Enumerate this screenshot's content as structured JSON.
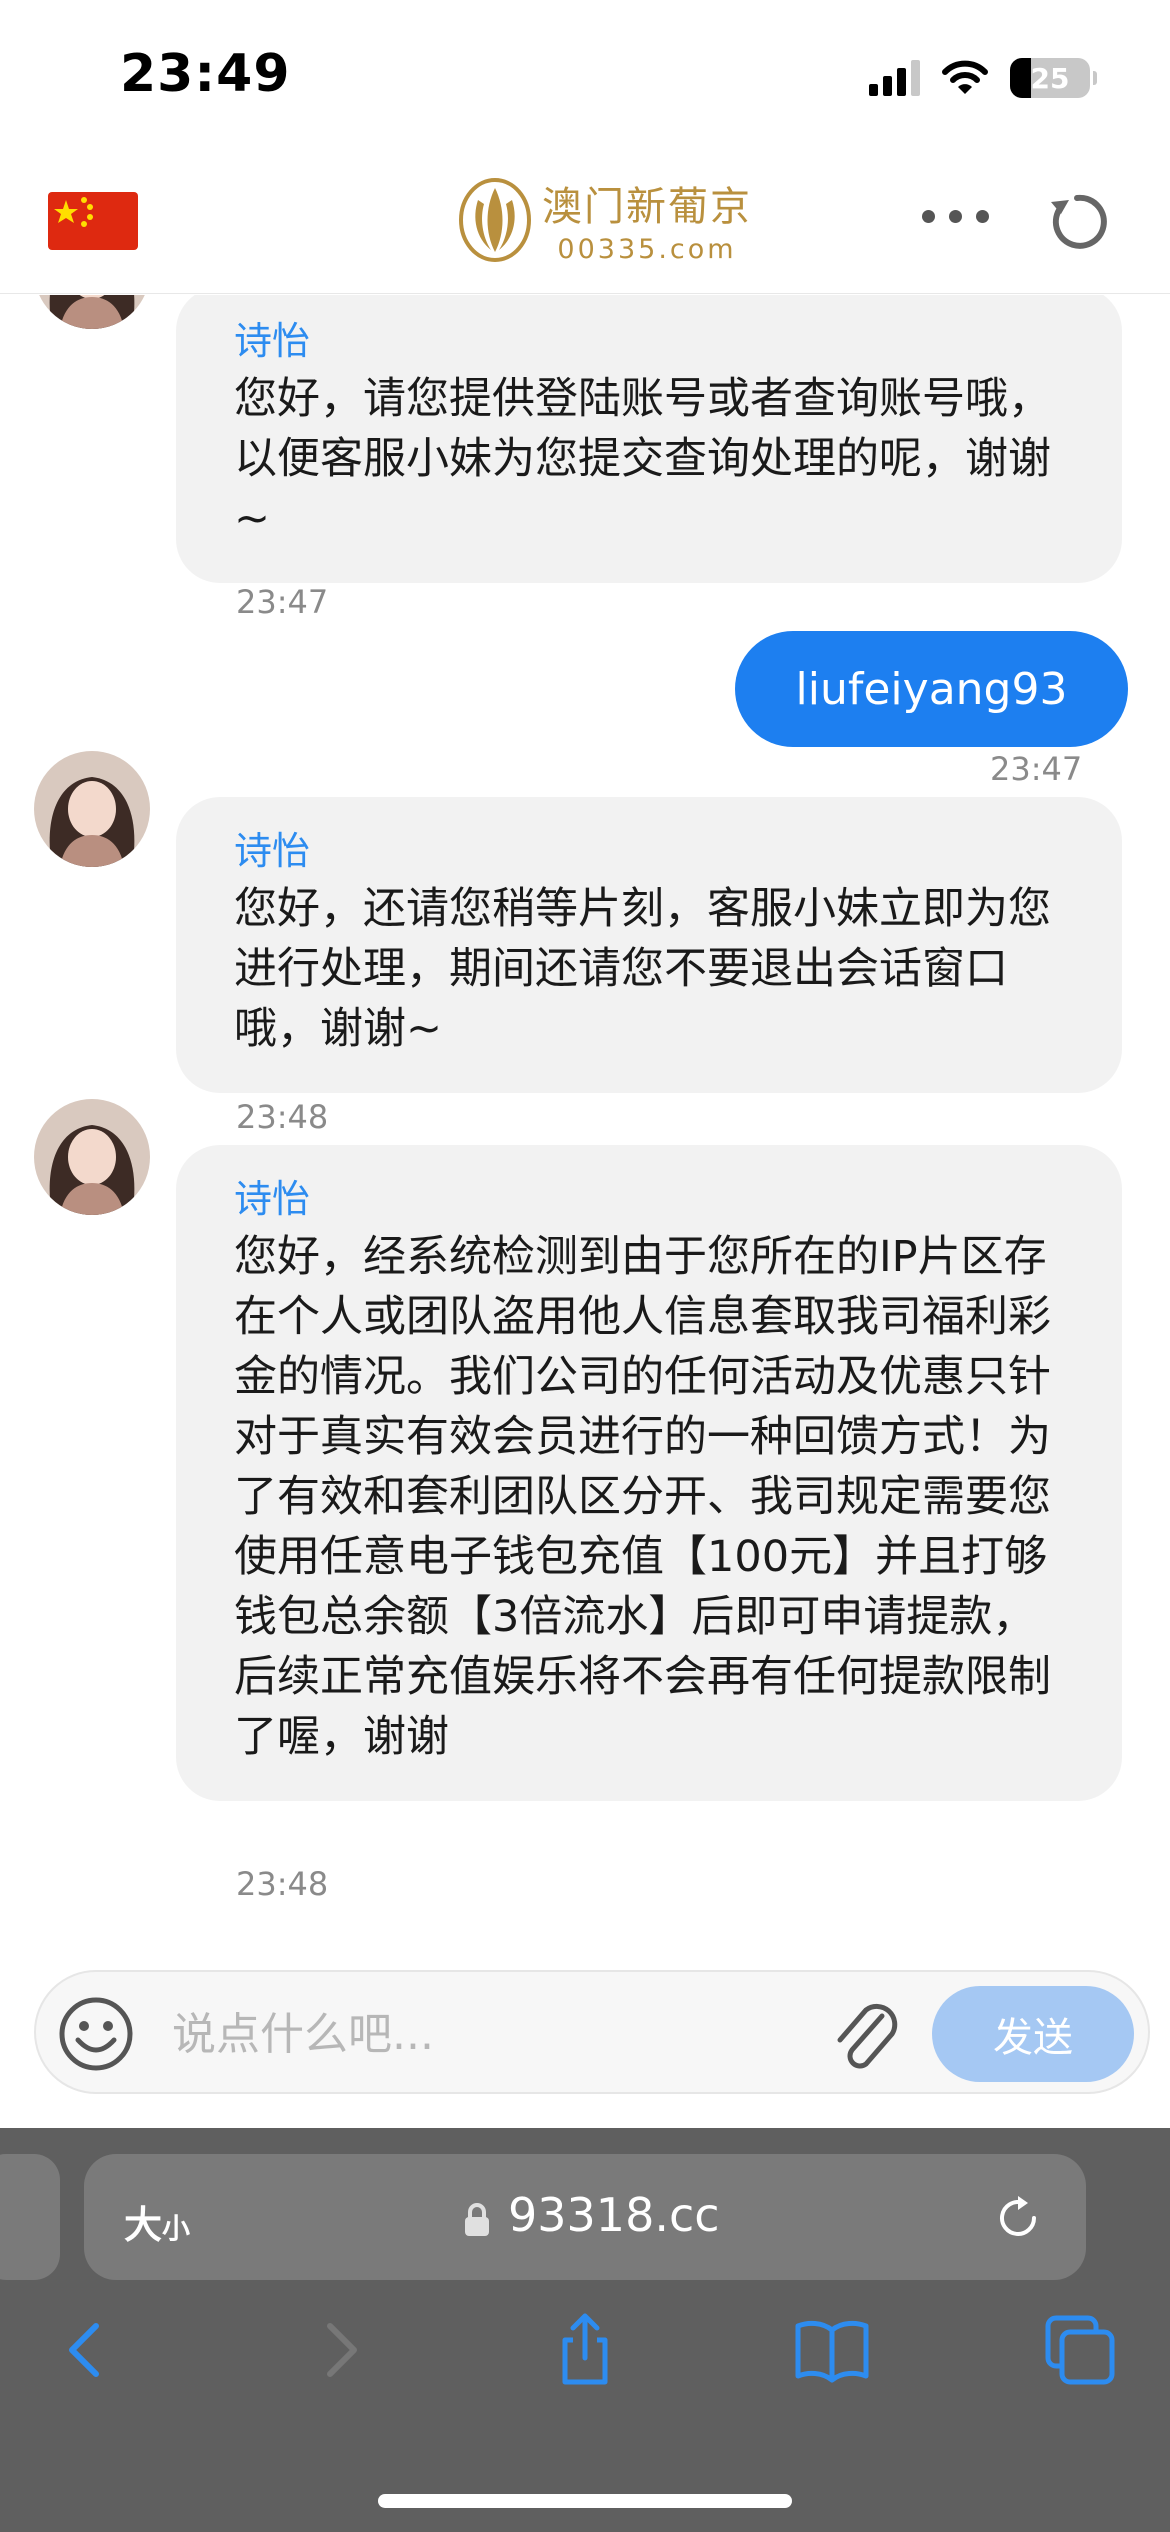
{
  "status_bar": {
    "time": "23:49",
    "battery": "25"
  },
  "header": {
    "logo_title": "澳门新葡京",
    "logo_domain": "00335.com"
  },
  "messages": [
    {
      "sender": "诗怡",
      "text": "您好，请您提供登陆账号或者查询账号哦，以便客服小妹为您提交查询处理的呢，谢谢~",
      "time": "23:47"
    },
    {
      "text": "liufeiyang93",
      "time": "23:47"
    },
    {
      "sender": "诗怡",
      "text": "您好，还请您稍等片刻，客服小妹立即为您进行处理，期间还请您不要退出会话窗口哦，谢谢~",
      "time": "23:48"
    },
    {
      "sender": "诗怡",
      "text": "您好，经系统检测到由于您所在的IP片区存在个人或团队盗用他人信息套取我司福利彩金的情况。我们公司的任何活动及优惠只针对于真实有效会员进行的一种回馈方式！为了有效和套利团队区分开、我司规定需要您使用任意电子钱包充值【100元】并且打够钱包总余额【3倍流水】后即可申请提款，后续正常充值娱乐将不会再有任何提款限制了喔，谢谢",
      "time": "23:48"
    }
  ],
  "input": {
    "placeholder": "说点什么吧...",
    "send_label": "发送"
  },
  "browser": {
    "reader_label": "大",
    "reader_small": "小",
    "url": "93318.cc"
  },
  "icons": {
    "flag": "china-flag-icon",
    "logo": "grand-lisboa-logo",
    "more": "more-dots-icon",
    "refresh": "refresh-icon",
    "emoji": "emoji-icon",
    "attach": "paperclip-icon",
    "lock": "lock-icon",
    "reload": "reload-icon",
    "back": "back-icon",
    "forward": "forward-icon",
    "share": "share-icon",
    "bookmarks": "bookmarks-icon",
    "tabs": "tabs-icon"
  },
  "colors": {
    "accent": "#1d7ff0",
    "sender_name": "#2d8cf0",
    "brand_gold": "#b9903e",
    "bubble_in": "#f2f2f2",
    "browser_bg": "#5f5f5f"
  }
}
